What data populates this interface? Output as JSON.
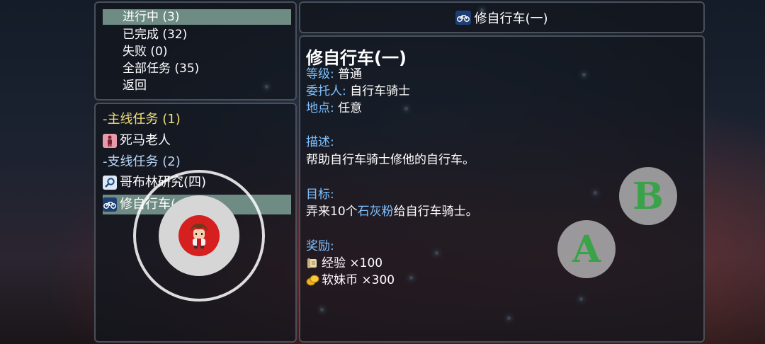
{
  "menu": {
    "items": [
      {
        "label": "进行中 (3)"
      },
      {
        "label": "已完成 (32)"
      },
      {
        "label": "失败 (0)"
      },
      {
        "label": "全部任务 (35)"
      },
      {
        "label": "返回"
      }
    ],
    "selected_index": 0
  },
  "quest_list": {
    "main_category": "-主线任务 (1)",
    "main_quests": [
      {
        "label": "死马老人",
        "icon": "person-icon"
      }
    ],
    "side_category": "-支线任务 (2)",
    "side_quests": [
      {
        "label": "哥布林研究(四)",
        "icon": "magnifier-icon"
      },
      {
        "label": "修自行车(一)",
        "icon": "bicycle-icon"
      }
    ],
    "selected": "修自行车(一)"
  },
  "header": {
    "title": "修自行车(一)",
    "icon": "bicycle-icon"
  },
  "detail": {
    "title": "修自行车(一)",
    "level_label": "等级:",
    "level_value": "普通",
    "client_label": "委托人:",
    "client_value": "自行车骑士",
    "location_label": "地点:",
    "location_value": "任意",
    "description_label": "描述:",
    "description_text": "帮助自行车骑士修他的自行车。",
    "objective_label": "目标:",
    "objective_prefix": "弄来10个",
    "objective_item": "石灰粉",
    "objective_suffix": "给自行车骑士。",
    "reward_label": "奖励:",
    "rewards": [
      {
        "label": "经验 ×100",
        "icon": "scroll-icon"
      },
      {
        "label": "软妹币 ×300",
        "icon": "coin-icon"
      }
    ]
  },
  "controls": {
    "button_b": "B",
    "button_a": "A"
  },
  "colors": {
    "highlight": "#6e8b84",
    "label_blue": "#7ec0ff",
    "category_yellow": "#f2e07a",
    "button_green": "#3aa34a",
    "joystick_red": "#d62020"
  }
}
